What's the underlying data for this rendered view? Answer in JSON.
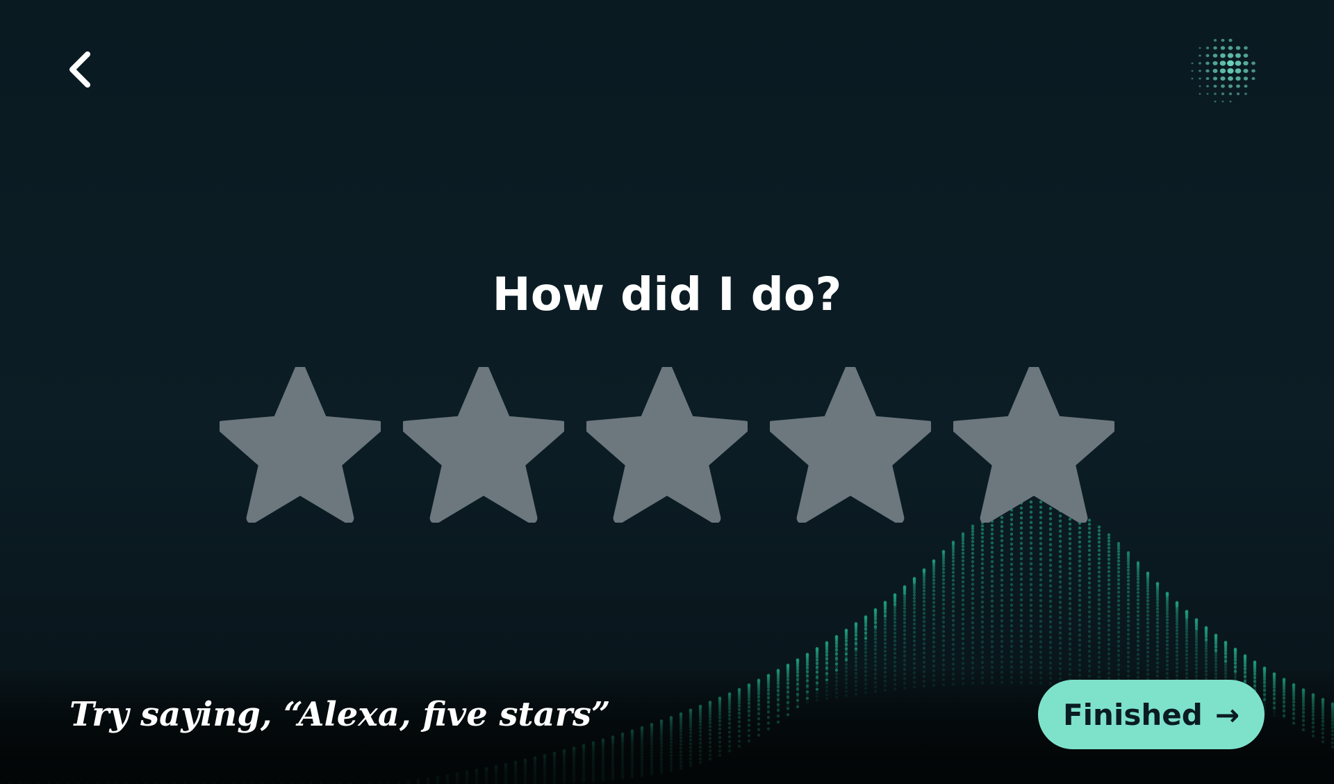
{
  "header": {
    "back_icon": "chevron-left-icon",
    "orb_icon": "alexa-orb-icon",
    "orb_color": "#6fd8bf"
  },
  "prompt": {
    "title": "How did I do?"
  },
  "rating": {
    "max_stars": 5,
    "selected": 0,
    "star_icon": "star-icon",
    "star_color": "#6c787e"
  },
  "footer": {
    "hint": "Try saying, “Alexa, five stars”",
    "finished_label": "Finished",
    "finished_arrow": "→",
    "finished_color": "#7ee2cb"
  }
}
